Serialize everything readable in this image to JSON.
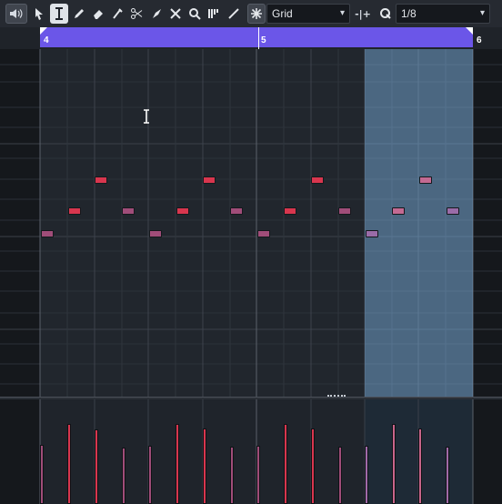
{
  "toolbar": {
    "tools": [
      {
        "name": "speaker-icon",
        "glyph": "🔈"
      },
      {
        "name": "object-selection-icon",
        "glyph": "↖"
      },
      {
        "name": "range-selection-icon",
        "glyph": "I"
      },
      {
        "name": "draw-icon",
        "glyph": "✎"
      },
      {
        "name": "erase-icon",
        "glyph": "⌫"
      },
      {
        "name": "trim-icon",
        "glyph": "✐"
      },
      {
        "name": "split-icon",
        "glyph": "✂"
      },
      {
        "name": "glue-icon",
        "glyph": "◢"
      },
      {
        "name": "mute-icon",
        "glyph": "✕"
      },
      {
        "name": "zoom-icon",
        "glyph": "⌕"
      },
      {
        "name": "comp-icon",
        "glyph": "▐"
      },
      {
        "name": "line-icon",
        "glyph": "∕"
      },
      {
        "name": "snap-icon",
        "glyph": "✵"
      }
    ],
    "snap_mode": "Grid",
    "snap_arrow": "▾",
    "snap_mode_icon": "-|+",
    "quantize_icon": "Q",
    "quantize_value": "1/8",
    "quantize_arrow": "▾"
  },
  "ruler": {
    "bars": [
      "4",
      "5",
      "6"
    ],
    "accent": "#6b56e8"
  },
  "editor": {
    "cursor_glyph": "I",
    "note_colors": {
      "red": "#d8364e",
      "mauve": "#a04d79"
    },
    "selection_color": "#78aad7"
  }
}
